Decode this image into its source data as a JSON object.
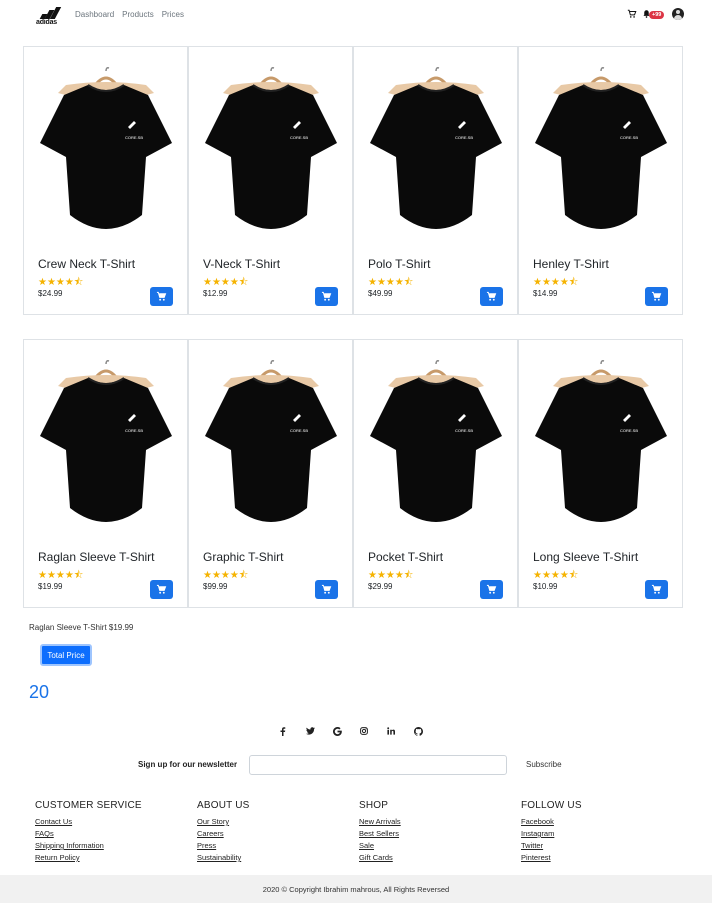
{
  "navbar": {
    "brand": "adidas",
    "links": [
      "Dashboard",
      "Products",
      "Prices"
    ],
    "notification_badge": "+99",
    "icons": [
      "cart-icon",
      "bell-icon",
      "user-avatar"
    ]
  },
  "products": [
    {
      "name": "Crew Neck T-Shirt",
      "price": "$24.99",
      "rating": 4.5
    },
    {
      "name": "V-Neck T-Shirt",
      "price": "$12.99",
      "rating": 4.5
    },
    {
      "name": "Polo T-Shirt",
      "price": "$49.99",
      "rating": 4.5
    },
    {
      "name": "Henley T-Shirt",
      "price": "$14.99",
      "rating": 4.5
    },
    {
      "name": "Raglan Sleeve T-Shirt",
      "price": "$19.99",
      "rating": 4.5
    },
    {
      "name": "Graphic T-Shirt",
      "price": "$99.99",
      "rating": 4.5
    },
    {
      "name": "Pocket T-Shirt",
      "price": "$29.99",
      "rating": 4.5
    },
    {
      "name": "Long Sleeve T-Shirt",
      "price": "$10.99",
      "rating": 4.5
    }
  ],
  "stars_text": "★★★★⯪",
  "selection": {
    "summary": "Raglan Sleeve T-Shirt $19.99",
    "total_button": "Total Price",
    "total_value": "20"
  },
  "social": [
    "f",
    "t",
    "G",
    "ig",
    "in",
    "gh"
  ],
  "newsletter": {
    "label": "Sign up for our newsletter",
    "input_value": "",
    "placeholder": "",
    "button": "Subscribe"
  },
  "footer": {
    "columns": [
      {
        "title": "CUSTOMER SERVICE",
        "links": [
          "Contact Us",
          "FAQs",
          "Shipping Information",
          "Return Policy"
        ]
      },
      {
        "title": "ABOUT US",
        "links": [
          "Our Story",
          "Careers",
          "Press",
          "Sustainability"
        ]
      },
      {
        "title": "SHOP",
        "links": [
          "New Arrivals",
          "Best Sellers",
          "Sale",
          "Gift Cards"
        ]
      },
      {
        "title": "FOLLOW US",
        "links": [
          "Facebook",
          "Instagram",
          "Twitter",
          "Pinterest"
        ]
      }
    ],
    "copyright": "2020 © Copyright Ibrahim mahrous, All Rights Reversed"
  },
  "colors": {
    "primary": "#1a73e8",
    "star": "#f5b301",
    "badge": "#dc3545"
  }
}
